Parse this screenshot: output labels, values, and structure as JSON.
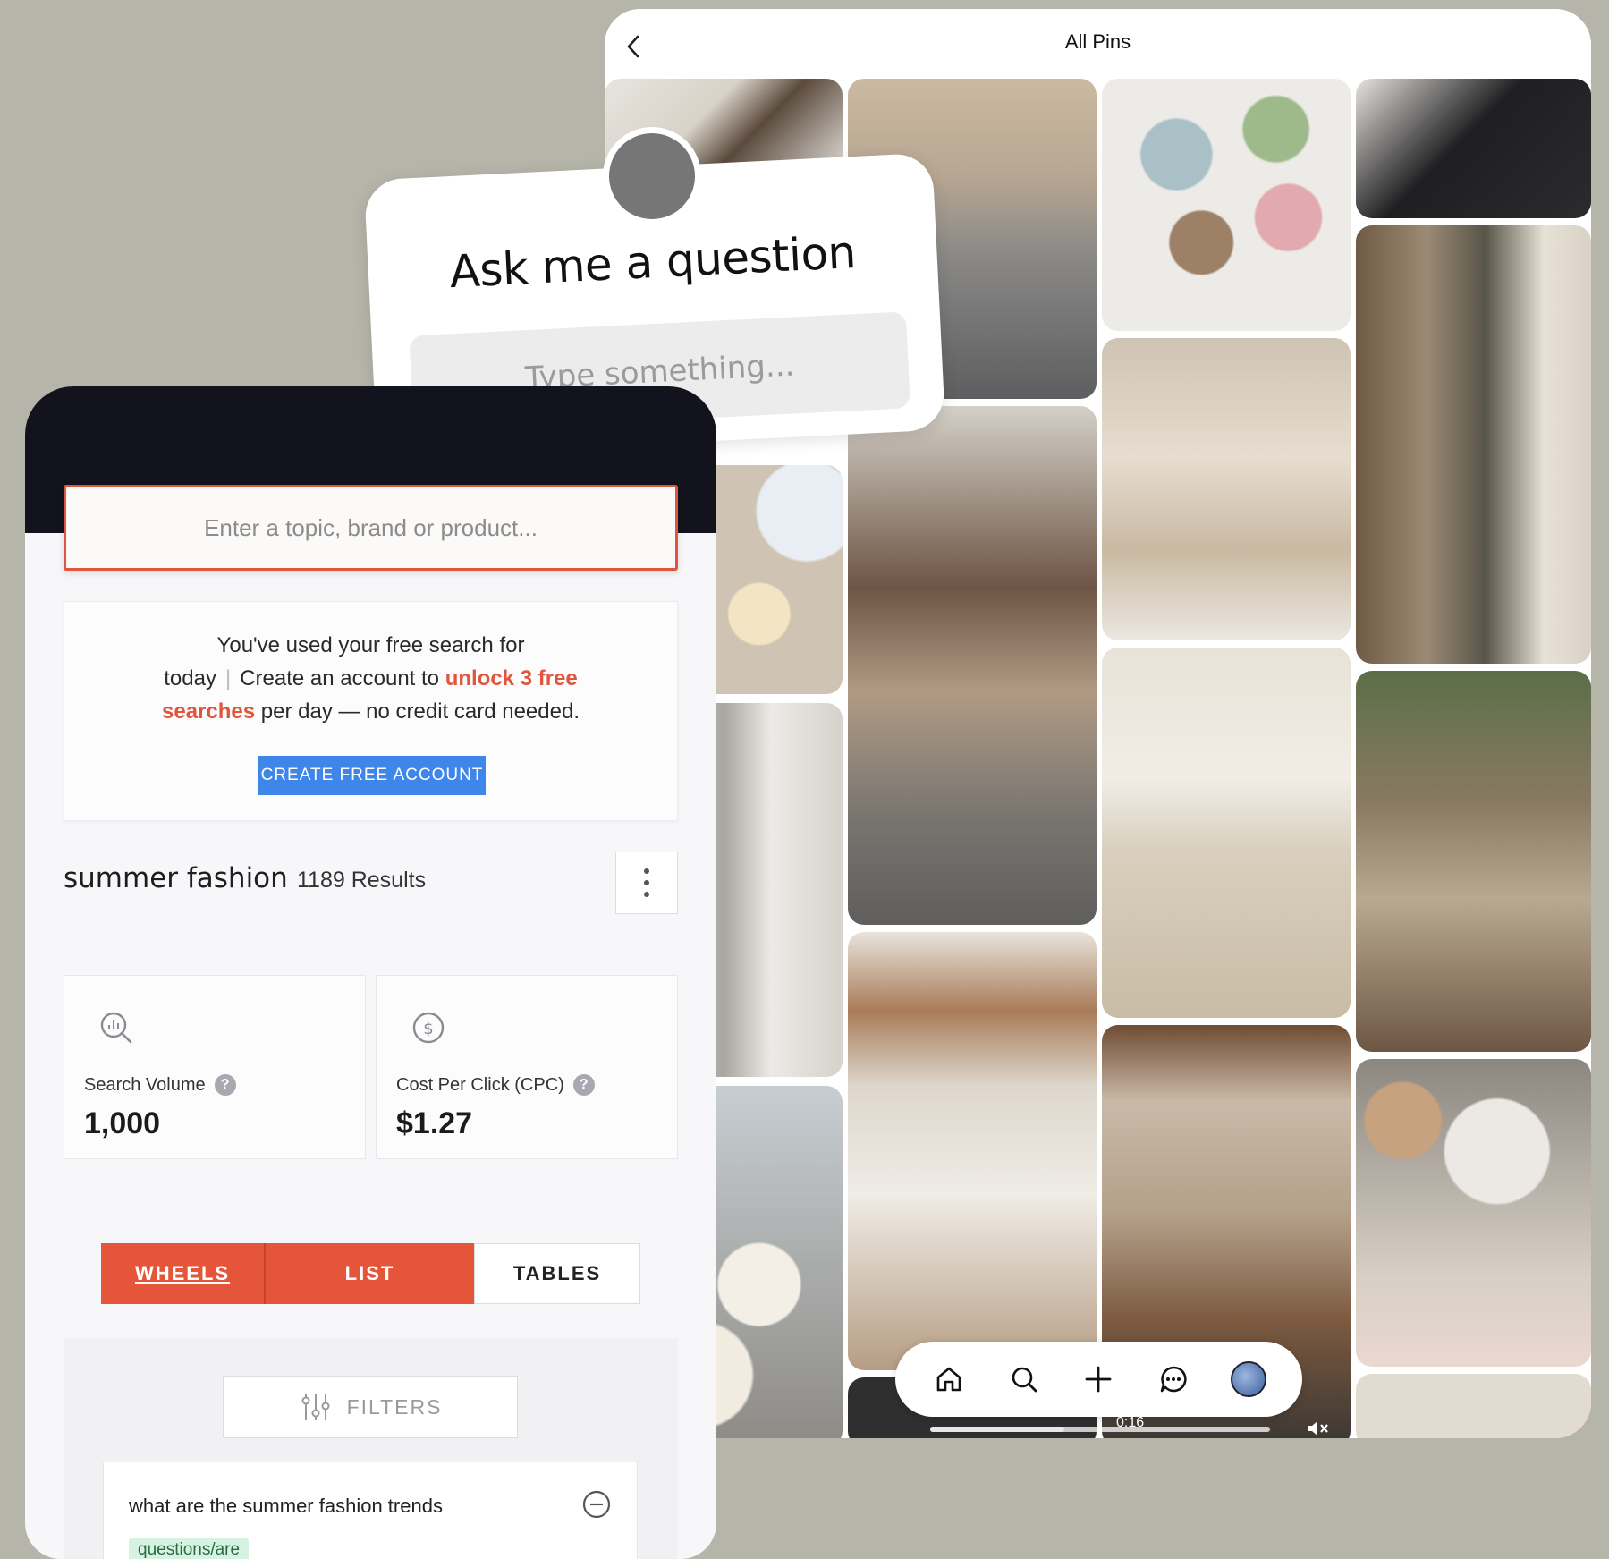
{
  "pins": {
    "title": "All Pins",
    "video_time": "0:16",
    "nav": [
      "home-icon",
      "search-icon",
      "add-icon",
      "messages-icon",
      "profile-avatar"
    ]
  },
  "question_sticker": {
    "title": "Ask me a question",
    "placeholder": "Type something..."
  },
  "keyword_tool": {
    "search_placeholder": "Enter a topic, brand or product...",
    "notice": {
      "line1": "You've used your free search for",
      "today": "today",
      "create_text": "Create an account to",
      "highlight1": "unlock 3 free",
      "highlight2": "searches",
      "tail": "per day — no credit card needed.",
      "button": "CREATE FREE ACCOUNT"
    },
    "term": "summer fashion",
    "results": "1189 Results",
    "stats": [
      {
        "label": "Search Volume",
        "value": "1,000",
        "icon": "chart-search-icon"
      },
      {
        "label": "Cost Per Click (CPC)",
        "value": "$1.27",
        "icon": "dollar-icon"
      }
    ],
    "tabs": [
      "WHEELS",
      "LIST",
      "TABLES"
    ],
    "filters_label": "FILTERS",
    "list_items": [
      {
        "text": "what are the summer fashion trends",
        "badge": "questions/are"
      }
    ]
  }
}
